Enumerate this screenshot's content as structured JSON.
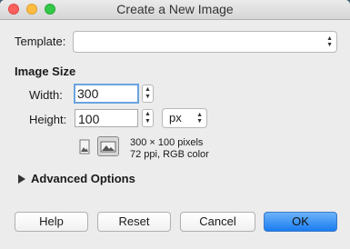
{
  "window": {
    "title": "Create a New Image"
  },
  "template": {
    "label": "Template:",
    "value": ""
  },
  "image_size": {
    "heading": "Image Size",
    "width_label": "Width:",
    "width_value": "300",
    "height_label": "Height:",
    "height_value": "100",
    "unit": "px"
  },
  "info": {
    "pixels": "300 × 100 pixels",
    "details": "72 ppi, RGB color"
  },
  "advanced": {
    "label": "Advanced Options"
  },
  "buttons": {
    "help": "Help",
    "reset": "Reset",
    "cancel": "Cancel",
    "ok": "OK"
  },
  "colors": {
    "accent": "#1a7cf0",
    "focus_ring": "#6aa3e0"
  },
  "icons": [
    "close-icon",
    "minimize-icon",
    "zoom-icon",
    "portrait-orientation-icon",
    "landscape-orientation-icon",
    "disclosure-triangle-icon"
  ]
}
